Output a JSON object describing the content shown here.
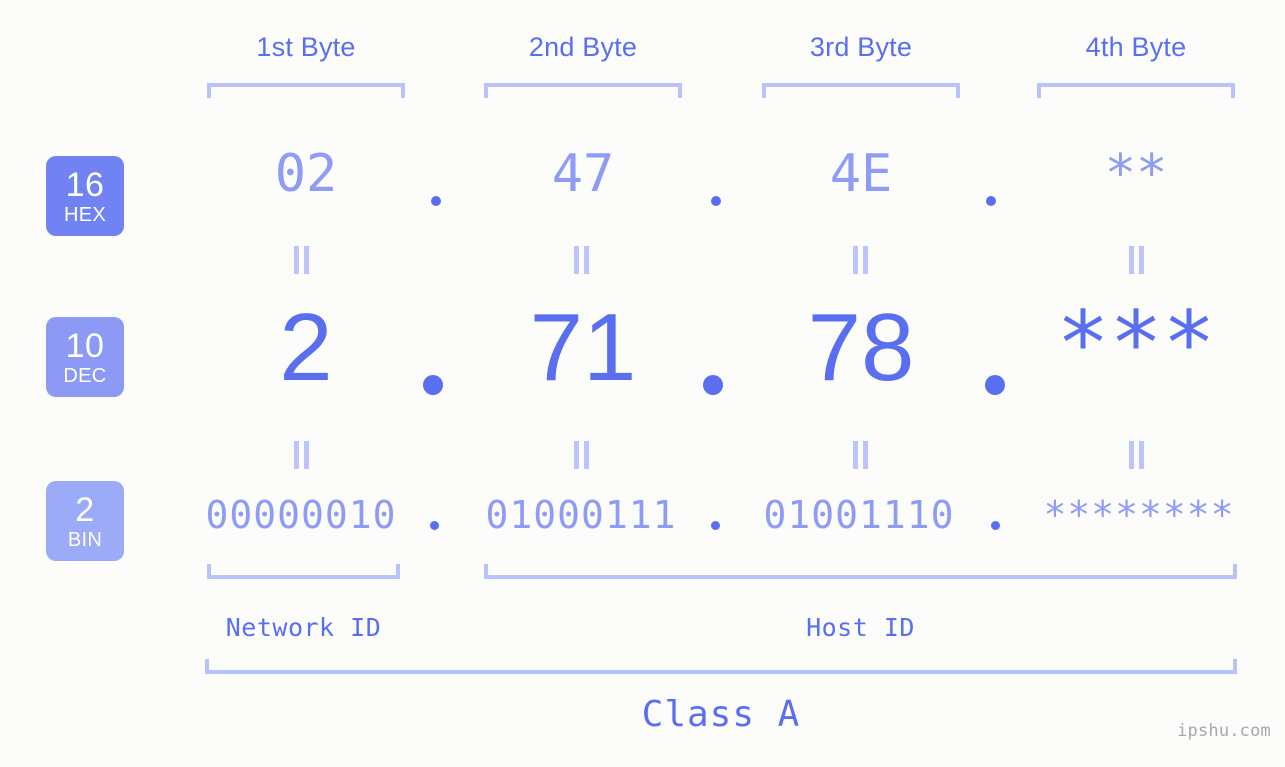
{
  "meta": {
    "background_color": "#fcfdfa",
    "accent_color": "#5a6ff0",
    "accent_light_color": "#8f9cf6",
    "bracket_color": "#b9c2fb",
    "watermark": "ipshu.com"
  },
  "byte_headers": [
    {
      "label": "1st Byte"
    },
    {
      "label": "2nd Byte"
    },
    {
      "label": "3rd Byte"
    },
    {
      "label": "4th Byte"
    }
  ],
  "bases": [
    {
      "num": "16",
      "name": "HEX",
      "color": "#7182f2"
    },
    {
      "num": "10",
      "name": "DEC",
      "color": "#8c9af5"
    },
    {
      "num": "2",
      "name": "BIN",
      "color": "#9babf8"
    }
  ],
  "rows": {
    "hex": {
      "values": [
        "02",
        "47",
        "4E",
        "**"
      ],
      "separator": "."
    },
    "dec": {
      "values": [
        "2",
        "71",
        "78",
        "***"
      ],
      "separator": "."
    },
    "bin": {
      "values": [
        "00000010",
        "01000111",
        "01001110",
        "********"
      ],
      "separator": "."
    }
  },
  "equals_symbol": "=",
  "segments": {
    "network_id": "Network ID",
    "host_id": "Host ID",
    "class": "Class A"
  }
}
